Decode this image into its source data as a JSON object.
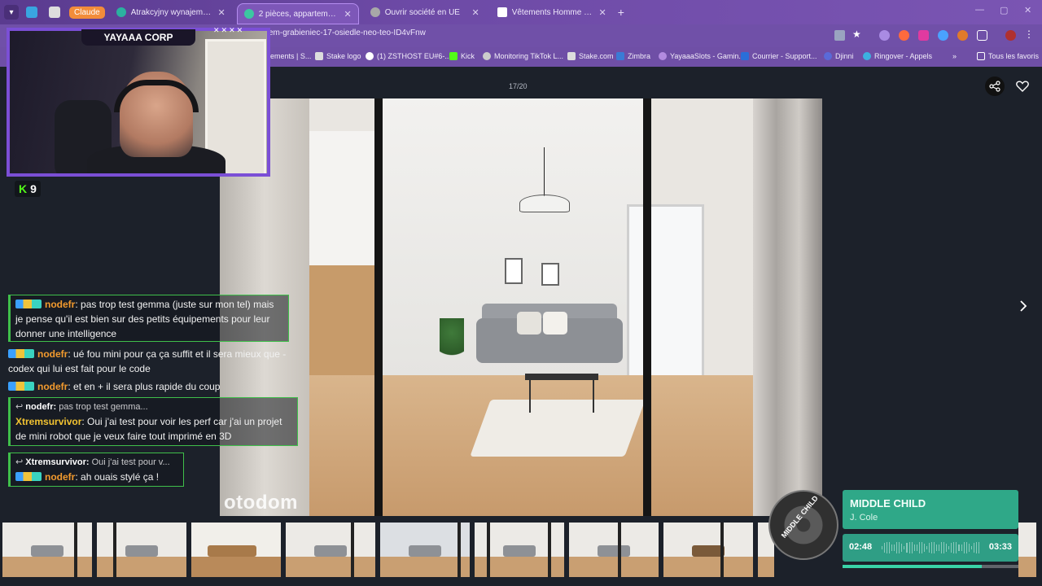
{
  "browser": {
    "tab_group_label": "Claude",
    "tabs": [
      {
        "label": "Atrakcyjny wynajem - Łódź - sp",
        "active": false,
        "favicon_color": "#2bb1a0"
      },
      {
        "label": "2 pièces, appartement à louer",
        "active": true,
        "favicon_color": "#3cc7a1"
      },
      {
        "label": "Ouvrir société en UE",
        "active": false,
        "favicon_color": "#a8a8a8"
      },
      {
        "label": "Vêtements Homme | Next",
        "active": false,
        "favicon_color": "#ffffff"
      }
    ],
    "url": "em-grabieniec-17-osiedle-neo-teo-ID4vFnw",
    "bookmarks": [
      "ements | S...",
      "Stake logo",
      "(1) ZSTHOST EU#6-...",
      "Kick",
      "Monitoring TikTok L...",
      "Stake.com",
      "Zimbra",
      "YayaaaSlots - Gamin...",
      "Courrier - Support...",
      "Djinni",
      "Ringover - Appels"
    ],
    "all_bookmarks": "Tous les favoris"
  },
  "gallery": {
    "counter": "17/20",
    "watermark": "otodom",
    "thumbnail_count": 11
  },
  "stream": {
    "title": "YAYAAA CORP",
    "stars": "✕✕✕✕",
    "viewers": "9",
    "chat": [
      {
        "user": "nodefr",
        "text": "pas trop test gemma (juste sur mon tel) mais je pense qu'il est bien sur des petits équipements pour leur donner une intelligence"
      },
      {
        "user": "nodefr",
        "text": "ué fou mini pour ça ça suffit et il sera mieux que -codex qui lui est fait pour le code"
      },
      {
        "user": "nodefr",
        "text": "et en + il sera plus rapide du coup"
      },
      {
        "reply_user": "nodefr:",
        "reply_preview": "pas trop test gemma...",
        "user": "Xtremsurvivor",
        "text": "Oui j'ai test pour voir les perf car j'ai un projet de mini robot que je veux faire tout imprimé en 3D"
      },
      {
        "reply_user": "Xtremsurvivor:",
        "reply_preview": "Oui j'ai test pour v...",
        "user": "nodefr",
        "text": "ah ouais stylé ça !"
      }
    ]
  },
  "music": {
    "title": "MIDDLE CHILD",
    "artist": "J. Cole",
    "elapsed": "02:48",
    "total": "03:33",
    "progress": 0.79,
    "disc_label": "MIDDLE CHILD",
    "accent": "#2fa888"
  }
}
